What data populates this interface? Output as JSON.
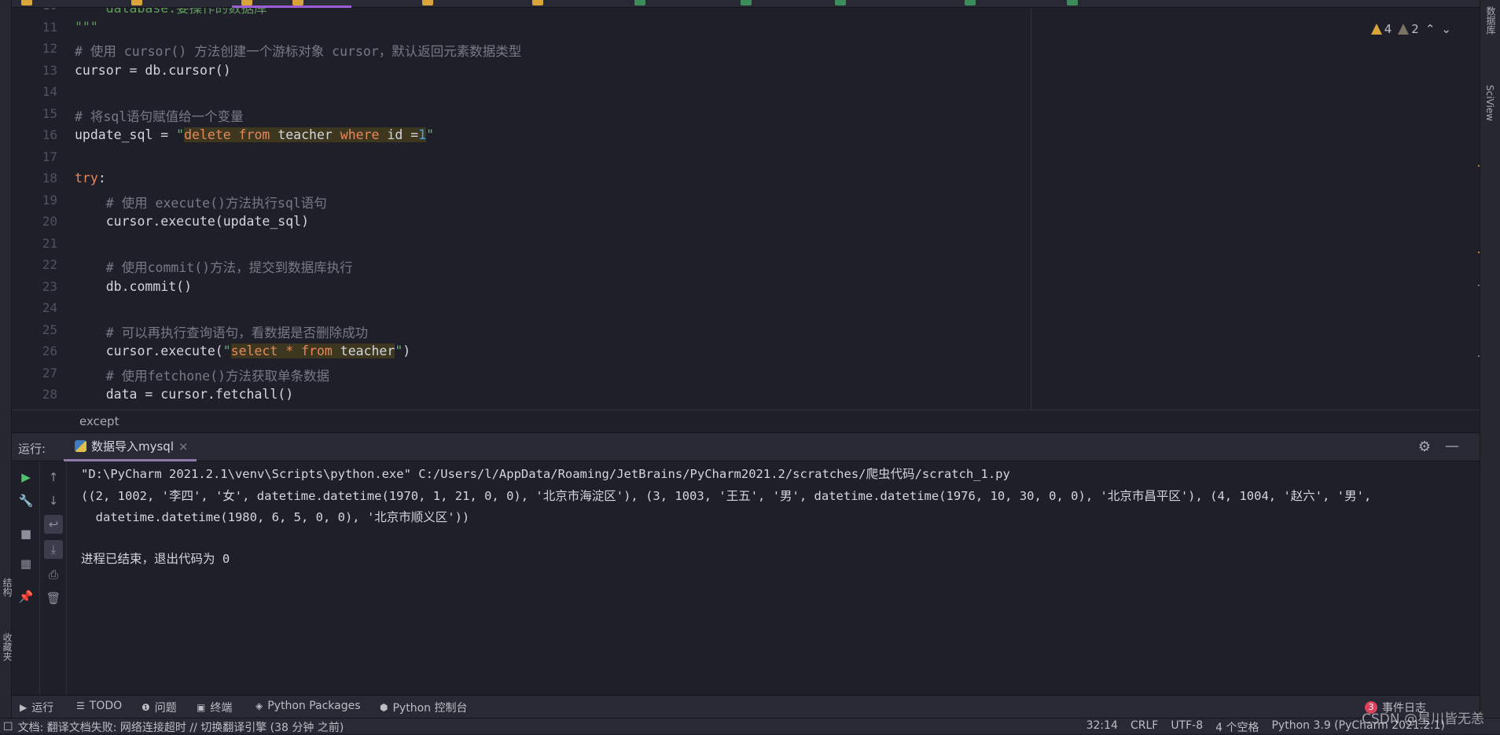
{
  "window": {
    "active_tab_index": 2
  },
  "tabs": [
    {
      "icon": "python-file-icon"
    },
    {
      "icon": "python-file-icon"
    },
    {
      "icon": "python-file-icon"
    },
    {
      "icon": "python-file-icon"
    },
    {
      "icon": "python-file-icon"
    },
    {
      "icon": "python-file-icon"
    },
    {
      "icon": "json-file-icon"
    },
    {
      "icon": "json-file-icon"
    },
    {
      "icon": "spreadsheet-icon"
    },
    {
      "icon": "spreadsheet-icon"
    },
    {
      "icon": "spreadsheet-icon"
    }
  ],
  "left_strip": {
    "structure": "结构",
    "favorites": "收藏夹"
  },
  "right_strip": {
    "database": "数据库",
    "sciview": "SciView"
  },
  "inspections": {
    "warnings": "4",
    "weak_warnings": "2"
  },
  "editor": {
    "lines": [
      {
        "n": "10",
        "tokens": [
          [
            "    database:要操作的数据库",
            "doc"
          ]
        ]
      },
      {
        "n": "11",
        "tokens": [
          [
            "\"\"\"",
            "doc"
          ]
        ]
      },
      {
        "n": "12",
        "tokens": [
          [
            "# 使用 cursor() 方法创建一个游标对象 cursor，默认返回元素数据类型",
            "cm"
          ]
        ]
      },
      {
        "n": "13",
        "tokens": [
          [
            "cursor = db.cursor()",
            "df"
          ]
        ]
      },
      {
        "n": "14",
        "tokens": []
      },
      {
        "n": "15",
        "tokens": [
          [
            "# 将sql语句赋值给一个变量",
            "cm"
          ]
        ]
      },
      {
        "n": "16",
        "tokens": [
          [
            "update_sql = ",
            "df"
          ],
          [
            "\"",
            "st"
          ],
          [
            "delete from ",
            "sq hl"
          ],
          [
            "teacher ",
            "df hl"
          ],
          [
            "where ",
            "sq hl"
          ],
          [
            "id =",
            "df hl"
          ],
          [
            "1",
            "num hl"
          ],
          [
            "\"",
            "st"
          ]
        ]
      },
      {
        "n": "17",
        "tokens": []
      },
      {
        "n": "18",
        "tokens": [
          [
            "try",
            "kw"
          ],
          [
            ":",
            "df"
          ]
        ]
      },
      {
        "n": "19",
        "tokens": [
          [
            "    # 使用 execute()方法执行sql语句",
            "cm"
          ]
        ]
      },
      {
        "n": "20",
        "tokens": [
          [
            "    cursor.execute(update_sql)",
            "df"
          ]
        ]
      },
      {
        "n": "21",
        "tokens": []
      },
      {
        "n": "22",
        "tokens": [
          [
            "    # 使用commit()方法，提交到数据库执行",
            "cm"
          ]
        ]
      },
      {
        "n": "23",
        "tokens": [
          [
            "    db.commit()",
            "df"
          ]
        ]
      },
      {
        "n": "24",
        "tokens": []
      },
      {
        "n": "25",
        "tokens": [
          [
            "    # 可以再执行查询语句，看数据是否删除成功",
            "cm"
          ]
        ]
      },
      {
        "n": "26",
        "tokens": [
          [
            "    cursor.execute(",
            "df"
          ],
          [
            "\"",
            "st"
          ],
          [
            "select * from ",
            "sq hl"
          ],
          [
            "teacher",
            "df hl"
          ],
          [
            "\"",
            "st"
          ],
          [
            ")",
            "df"
          ]
        ]
      },
      {
        "n": "27",
        "tokens": [
          [
            "    # 使用fetchone()方法获取单条数据",
            "cm"
          ]
        ]
      },
      {
        "n": "28",
        "tokens": [
          [
            "    data = cursor.fetchall()",
            "df"
          ]
        ]
      }
    ],
    "breadcrumb": "except"
  },
  "run": {
    "label": "运行:",
    "tab": "数据导入mysql",
    "output": [
      "\"D:\\PyCharm 2021.2.1\\venv\\Scripts\\python.exe\" C:/Users/l/AppData/Roaming/JetBrains/PyCharm2021.2/scratches/爬虫代码/scratch_1.py",
      "((2, 1002, '李四', '女', datetime.datetime(1970, 1, 21, 0, 0), '北京市海淀区'), (3, 1003, '王五', '男', datetime.datetime(1976, 10, 30, 0, 0), '北京市昌平区'), (4, 1004, '赵六', '男',",
      "  datetime.datetime(1980, 6, 5, 0, 0), '北京市顺义区'))",
      "",
      "进程已结束，退出代码为 0"
    ]
  },
  "tool_tabs": [
    {
      "label": "运行",
      "icon": "play-icon"
    },
    {
      "label": "TODO",
      "icon": "list-icon"
    },
    {
      "label": "问题",
      "icon": "problems-icon"
    },
    {
      "label": "终端",
      "icon": "terminal-icon"
    },
    {
      "label": "Python Packages",
      "icon": "packages-icon"
    },
    {
      "label": "Python 控制台",
      "icon": "python-console-icon"
    }
  ],
  "event_log": {
    "label": "事件日志",
    "count": "3"
  },
  "status": {
    "message": "文档: 翻译文档失败: 网络连接超时 // 切换翻译引擎 (38 分钟 之前)",
    "position": "32:14",
    "line_sep": "CRLF",
    "encoding": "UTF-8",
    "indent": "4 个空格",
    "interpreter": "Python 3.9 (PyCharm 2021.2.1)"
  },
  "watermark": "CSDN @星川皆无恙",
  "colors": {
    "accent": "#9d5dd6",
    "background": "#1e1f29",
    "warning": "#d9a53a"
  }
}
